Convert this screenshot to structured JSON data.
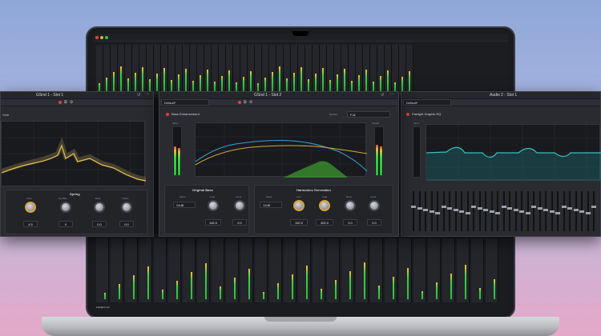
{
  "panels": {
    "reverb": {
      "title": "GSnd 1 - Slot 1",
      "plugin_label": "Verb",
      "section_label": "Spring",
      "knobs": [
        {
          "label": "Time",
          "value": "4.5"
        },
        {
          "label": "Dry/Wet",
          "value": "0"
        },
        {
          "label": "Bass",
          "value": "0.0"
        },
        {
          "label": "Treble",
          "value": "0.0"
        }
      ]
    },
    "bass": {
      "title": "GSnd 1 - Slot 2",
      "preset": "Default*",
      "plugin_label": "Bass Enhancement",
      "monitor_label": "Monitor",
      "monitor_value": "Full",
      "input_label": "Input",
      "output_label": "Output",
      "original": {
        "title": "Original Bass",
        "slope_label": "Slope",
        "slope_value": "24dB",
        "freq_label": "Freq",
        "freq_value": "146.0",
        "level_label": "Level",
        "level_value": "0.0"
      },
      "harmonics": {
        "title": "Harmonics Generation",
        "slope_label": "Slope",
        "slope_value": "12dB",
        "low_label": "Low",
        "low_value": "150.0",
        "high_label": "High",
        "high_value": "400.0",
        "drive_label": "Drive",
        "drive_value": "0.0",
        "level_label": "Level",
        "level_value": "0.0"
      }
    },
    "eq": {
      "title": "Audio 2 - Slot 1",
      "preset": "Default*",
      "plugin_label": "Fairlight Graphic EQ",
      "input_label": "Input"
    }
  },
  "screen": {
    "bottom_left": "Fairlight Live"
  },
  "colors": {
    "accent_gold": "#d7a53a",
    "accent_blue": "#3a9bd8",
    "eq_teal": "#3bbfc0",
    "meter_green": "#2ebd3a"
  }
}
